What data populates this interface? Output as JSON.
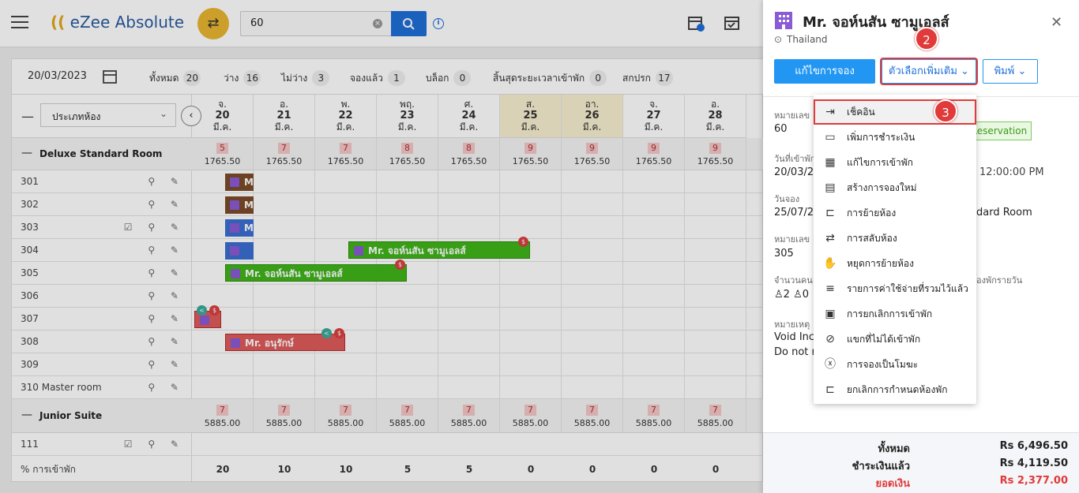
{
  "app": {
    "name": "eZee Absolute",
    "search_value": "60"
  },
  "stats": {
    "date": "20/03/2023",
    "items": [
      {
        "label": "ทั้งหมด",
        "count": "20"
      },
      {
        "label": "ว่าง",
        "count": "16"
      },
      {
        "label": "ไม่ว่าง",
        "count": "3"
      },
      {
        "label": "จองแล้ว",
        "count": "1"
      },
      {
        "label": "บล็อก",
        "count": "0"
      },
      {
        "label": "สิ้นสุดระยะเวลาเข้าพัก",
        "count": "0"
      },
      {
        "label": "สกปรก",
        "count": "17"
      }
    ]
  },
  "roomtype_select": "ประเภทห้อง",
  "days": [
    {
      "dow": "จ.",
      "day": "20",
      "month": "มี.ค."
    },
    {
      "dow": "อ.",
      "day": "21",
      "month": "มี.ค."
    },
    {
      "dow": "พ.",
      "day": "22",
      "month": "มี.ค."
    },
    {
      "dow": "พฤ.",
      "day": "23",
      "month": "มี.ค."
    },
    {
      "dow": "ศ.",
      "day": "24",
      "month": "มี.ค."
    },
    {
      "dow": "ส.",
      "day": "25",
      "month": "มี.ค."
    },
    {
      "dow": "อา.",
      "day": "26",
      "month": "มี.ค."
    },
    {
      "dow": "จ.",
      "day": "27",
      "month": "มี.ค."
    },
    {
      "dow": "อ.",
      "day": "28",
      "month": "มี.ค."
    }
  ],
  "groups": [
    {
      "name": "Deluxe Standard Room",
      "avail": [
        "5",
        "7",
        "7",
        "8",
        "8",
        "9",
        "9",
        "9",
        "9"
      ],
      "price": "1765.50"
    },
    {
      "name": "Junior Suite",
      "avail": [
        "7",
        "7",
        "7",
        "7",
        "7",
        "7",
        "7",
        "7",
        "7"
      ],
      "price": "5885.00"
    }
  ],
  "rooms": [
    "301",
    "302",
    "303",
    "304",
    "305",
    "306",
    "307",
    "308",
    "309",
    "310 Master room"
  ],
  "suite_rooms": [
    "111"
  ],
  "occupancy": {
    "label": "% การเข้าพัก",
    "values": [
      "20",
      "10",
      "10",
      "5",
      "5",
      "0",
      "0",
      "0",
      "0"
    ]
  },
  "bookings": {
    "b304": "Mr. จอห์นสัน ซามูเอลส์",
    "b305": "Mr. จอห์นสัน ซามูเอลส์",
    "b308": "Mr. อนุรักษ์",
    "short": "M"
  },
  "drawer": {
    "title": "Mr. จอห์นสัน ซามูเอลส์",
    "country": "Thailand",
    "edit_btn": "แก้ไขการจอง",
    "more_btn": "ตัวเลือกเพิ่มเติม",
    "print_btn": "พิมพ์",
    "f1_label": "หมายเลข",
    "f1_val": "60",
    "status": "Reservation",
    "f2_label": "วันที่เข้าพัก",
    "f2_val": "20/03/20",
    "f2_time": "12:00:00 PM",
    "f3_label": "วันจอง",
    "f3_val": "25/07/20",
    "f3_room": "dard Room",
    "f4_label": "หมายเลข",
    "f4_val": "305",
    "f5_label": "จำนวนคน",
    "f5_val": "2",
    "f5_val2": "0",
    "f5_right": "้องพักรายวัน",
    "f6_label": "หมายเหตุ",
    "f6_val1": "Void Incl",
    "f6_val2": "Do not no",
    "total_label": "ทั้งหมด",
    "total_val": "Rs 6,496.50",
    "paid_label": "ชำระเงินแล้ว",
    "paid_val": "Rs 4,119.50",
    "balance_label": "ยอดเงิน",
    "balance_val": "Rs 2,377.00"
  },
  "menu": [
    {
      "label": "เช็คอิน",
      "icon": "checkin-icon"
    },
    {
      "label": "เพิ่มการชำระเงิน",
      "icon": "payment-icon"
    },
    {
      "label": "แก้ไขการเข้าพัก",
      "icon": "edit-stay-icon"
    },
    {
      "label": "สร้างการจองใหม่",
      "icon": "calendar-icon"
    },
    {
      "label": "การย้ายห้อง",
      "icon": "room-move-icon"
    },
    {
      "label": "การสลับห้อง",
      "icon": "room-swap-icon"
    },
    {
      "label": "หยุดการย้ายห้อง",
      "icon": "hand-icon"
    },
    {
      "label": "รายการค่าใช้จ่ายที่รวมไว้แล้ว",
      "icon": "charges-icon"
    },
    {
      "label": "การยกเลิกการเข้าพัก",
      "icon": "cancel-stay-icon"
    },
    {
      "label": "แขกที่ไม่ได้เข้าพัก",
      "icon": "no-show-icon"
    },
    {
      "label": "การจองเป็นโมฆะ",
      "icon": "void-icon"
    },
    {
      "label": "ยกเลิกการกำหนดห้องพัก",
      "icon": "unassign-icon"
    }
  ],
  "steps": [
    "2",
    "3"
  ]
}
